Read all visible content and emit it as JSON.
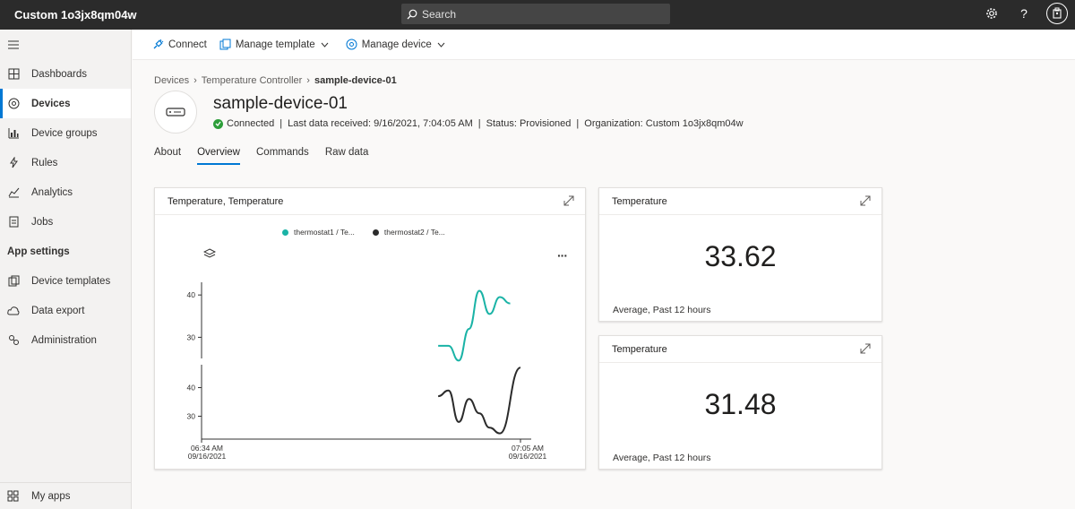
{
  "app": {
    "title": "Custom 1o3jx8qm04w"
  },
  "search": {
    "label": "Search"
  },
  "sidebar": {
    "items": [
      {
        "label": "Dashboards",
        "icon": "dashboard-icon"
      },
      {
        "label": "Devices",
        "icon": "devices-icon"
      },
      {
        "label": "Device groups",
        "icon": "device-groups-icon"
      },
      {
        "label": "Rules",
        "icon": "rules-icon"
      },
      {
        "label": "Analytics",
        "icon": "analytics-icon"
      },
      {
        "label": "Jobs",
        "icon": "jobs-icon"
      }
    ],
    "section": "App settings",
    "settings_items": [
      {
        "label": "Device templates",
        "icon": "device-templates-icon"
      },
      {
        "label": "Data export",
        "icon": "data-export-icon"
      },
      {
        "label": "Administration",
        "icon": "administration-icon"
      }
    ],
    "my_apps": "My apps"
  },
  "cmdbar": {
    "connect": "Connect",
    "manage_template": "Manage template",
    "manage_device": "Manage device"
  },
  "breadcrumb": [
    "Devices",
    "Temperature Controller",
    "sample-device-01"
  ],
  "device": {
    "name": "sample-device-01",
    "status": "Connected",
    "last_data": "Last data received: 9/16/2021, 7:04:05 AM",
    "provision": "Status: Provisioned",
    "organization": "Organization: Custom 1o3jx8qm04w"
  },
  "tabs": [
    "About",
    "Overview",
    "Commands",
    "Raw data"
  ],
  "chart_card": {
    "title": "Temperature, Temperature",
    "legend": [
      "thermostat1 / Te...",
      "thermostat2 / Te..."
    ],
    "x_start": "06:34 AM",
    "x_start_date": "09/16/2021",
    "x_end": "07:05 AM",
    "x_end_date": "09/16/2021"
  },
  "chart_data": {
    "type": "line",
    "x_range": [
      "06:34 AM 09/16/2021",
      "07:05 AM 09/16/2021"
    ],
    "series": [
      {
        "name": "thermostat1 / Te...",
        "color": "#1ab3a6",
        "ylim": [
          25,
          43
        ],
        "yticks": [
          30,
          40
        ],
        "x": [
          "06:57",
          "06:58",
          "06:59",
          "07:00",
          "07:01",
          "07:02",
          "07:03",
          "07:04"
        ],
        "values": [
          28,
          28,
          24.5,
          32,
          41,
          35.5,
          39.5,
          38
        ]
      },
      {
        "name": "thermostat2 / Te...",
        "color": "#2b2b2b",
        "ylim": [
          22,
          48
        ],
        "yticks": [
          30,
          40
        ],
        "x": [
          "06:57",
          "06:58",
          "06:59",
          "07:00",
          "07:01",
          "07:02",
          "07:03",
          "07:05"
        ],
        "values": [
          37,
          39,
          28,
          36,
          31,
          26,
          24,
          47
        ]
      }
    ],
    "grid": false,
    "legend_position": "top"
  },
  "kpi1": {
    "title": "Temperature",
    "value": "33.62",
    "footer": "Average, Past 12 hours"
  },
  "kpi2": {
    "title": "Temperature",
    "value": "31.48",
    "footer": "Average, Past 12 hours"
  },
  "colors": {
    "accent": "#0078d4",
    "topbar": "#2b2b2b",
    "connected": "#2d9e3a"
  }
}
